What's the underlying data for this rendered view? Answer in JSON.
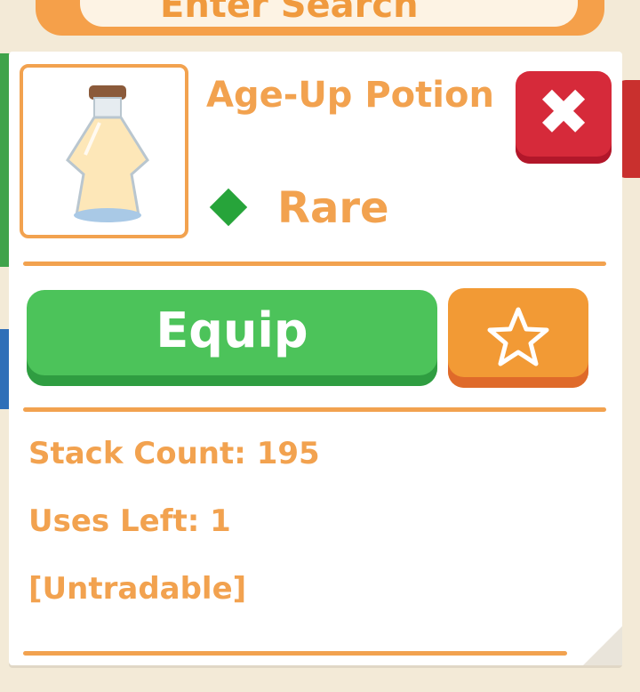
{
  "background": {
    "search_partial_text": "Enter Search"
  },
  "item": {
    "name": "Age-Up Potion",
    "rarity": "Rare",
    "rarity_color": "#27a43a",
    "icon": "potion-bottle-icon"
  },
  "actions": {
    "equip_label": "Equip",
    "close_glyph": "✖",
    "favorite_icon": "star-outline-icon"
  },
  "info": {
    "stack_count": "Stack Count: 195",
    "uses_left": "Uses Left: 1",
    "tradable": "[Untradable]"
  },
  "colors": {
    "accent": "#f2a24f",
    "equip": "#4cc35a",
    "close": "#d62a3a",
    "favorite": "#f29a35"
  }
}
